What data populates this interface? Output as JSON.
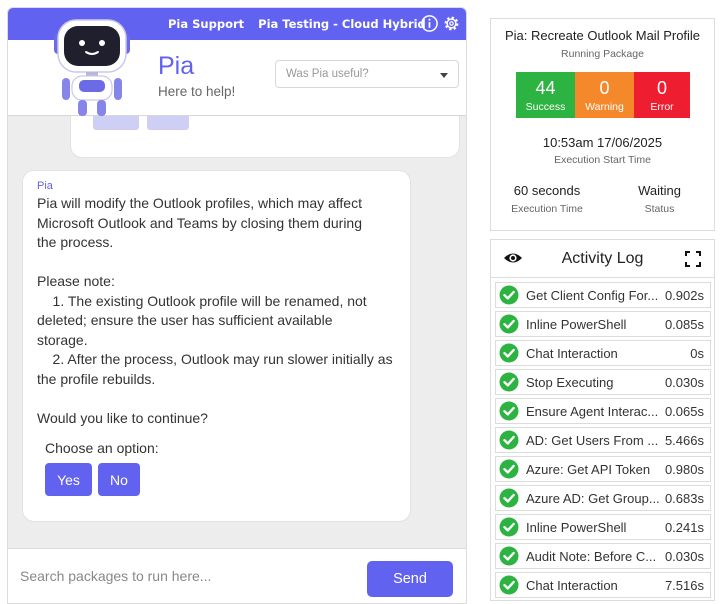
{
  "top_bar": {
    "link_support": "Pia Support",
    "link_tenant": "Pia Testing - Cloud Hybrid",
    "info_icon": "info-icon",
    "settings_icon": "gear-icon"
  },
  "header": {
    "title": "Pia",
    "subtitle": "Here to help!",
    "feedback_placeholder": "Was Pia useful?"
  },
  "message": {
    "sender": "Pia",
    "lines": [
      "Pia will modify the Outlook profiles, which may affect",
      "Microsoft Outlook and Teams by closing them during",
      "the process.",
      "Please note:",
      "    1. The existing Outlook profile will be renamed, not",
      "deleted; ensure the user has sufficient available",
      "storage.",
      "    2. After the process, Outlook may run slower initially as",
      "the profile rebuilds.",
      "Would you like to continue?"
    ],
    "choose_label": "Choose an option:",
    "yes_label": "Yes",
    "no_label": "No"
  },
  "input": {
    "placeholder": "Search packages to run here...",
    "send_label": "Send"
  },
  "status": {
    "package_title": "Pia: Recreate Outlook Mail Profile",
    "package_state": "Running Package",
    "success_count": "44",
    "success_label": "Success",
    "warning_count": "0",
    "warning_label": "Warning",
    "error_count": "0",
    "error_label": "Error",
    "start_time": "10:53am 17/06/2025",
    "start_label": "Execution Start Time",
    "exec_time": "60 seconds",
    "exec_label": "Execution Time",
    "status_value": "Waiting",
    "status_label": "Status",
    "colors": {
      "success": "#2db342",
      "warning": "#f5882b",
      "error": "#ee1d2f",
      "accent": "#6262f0"
    }
  },
  "activity_log": {
    "title": "Activity Log",
    "eye_icon": "eye-icon",
    "expand_icon": "fullscreen-icon",
    "check_icon": "check-circle-icon",
    "items": [
      {
        "name": "Get Client Config For...",
        "time": "0.902s"
      },
      {
        "name": "Inline PowerShell",
        "time": "0.085s"
      },
      {
        "name": "Chat Interaction",
        "time": "0s"
      },
      {
        "name": "Stop Executing",
        "time": "0.030s"
      },
      {
        "name": "Ensure Agent Interac...",
        "time": "0.065s"
      },
      {
        "name": "AD: Get Users From ...",
        "time": "5.466s"
      },
      {
        "name": "Azure: Get API Token",
        "time": "0.980s"
      },
      {
        "name": "Azure AD: Get Group...",
        "time": "0.683s"
      },
      {
        "name": "Inline PowerShell",
        "time": "0.241s"
      },
      {
        "name": "Audit Note: Before C...",
        "time": "0.030s"
      },
      {
        "name": "Chat Interaction",
        "time": "7.516s"
      }
    ]
  }
}
